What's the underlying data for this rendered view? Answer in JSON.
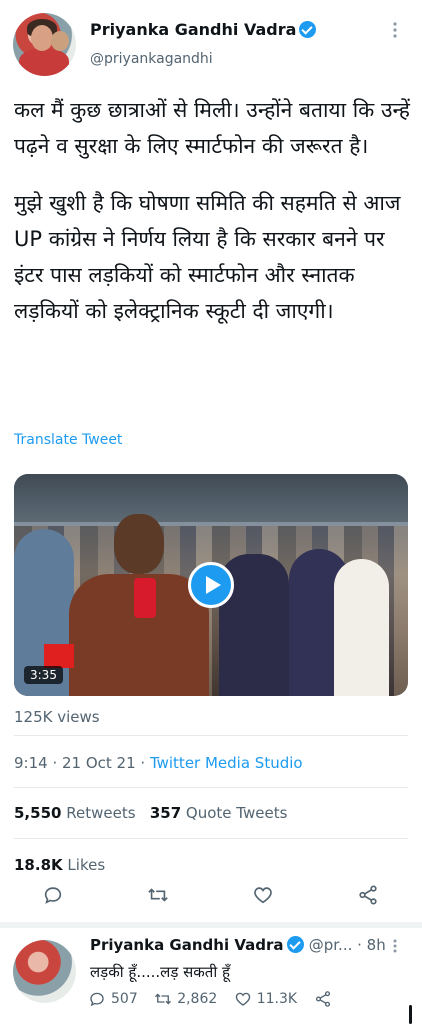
{
  "tweet": {
    "author_name": "Priyanka Gandhi Vadra",
    "handle": "@priyankagandhi",
    "text_p1": "कल मैं कुछ छात्राओं से मिली। उन्होंने बताया कि उन्हें पढ़ने व सुरक्षा के लिए स्मार्टफोन की जरूरत है।",
    "text_p2": "मुझे खुशी है कि घोषणा समिति की सहमति से आज UP कांग्रेस ने निर्णय लिया है कि सरकार बनने पर इंटर पास लड़कियों को स्मार्टफोन और स्नातक लड़कियों को इलेक्ट्रानिक स्कूटी दी जाएगी।",
    "translate_label": "Translate Tweet",
    "video_duration": "3:35",
    "views": "125K views",
    "time": "9:14 · 21 Oct 21 · ",
    "source": "Twitter Media Studio",
    "retweets_count": "5,550",
    "retweets_label": "Retweets",
    "quote_count": "357",
    "quote_label": "Quote Tweets",
    "likes_count": "18.8K",
    "likes_label": "Likes"
  },
  "reply": {
    "author_name": "Priyanka Gandhi Vadra",
    "handle_time": "@pr... · 8h",
    "text": "लड़की हूँ.....लड़ सकती हूँ",
    "replies": "507",
    "retweets": "2,862",
    "likes": "11.3K"
  },
  "icons": [
    "more-icon",
    "verified-icon",
    "play-icon",
    "reply-icon",
    "retweet-icon",
    "like-icon",
    "share-icon"
  ],
  "colors": {
    "accent": "#1d9bf0",
    "text": "#0f1419",
    "muted": "#536471"
  }
}
